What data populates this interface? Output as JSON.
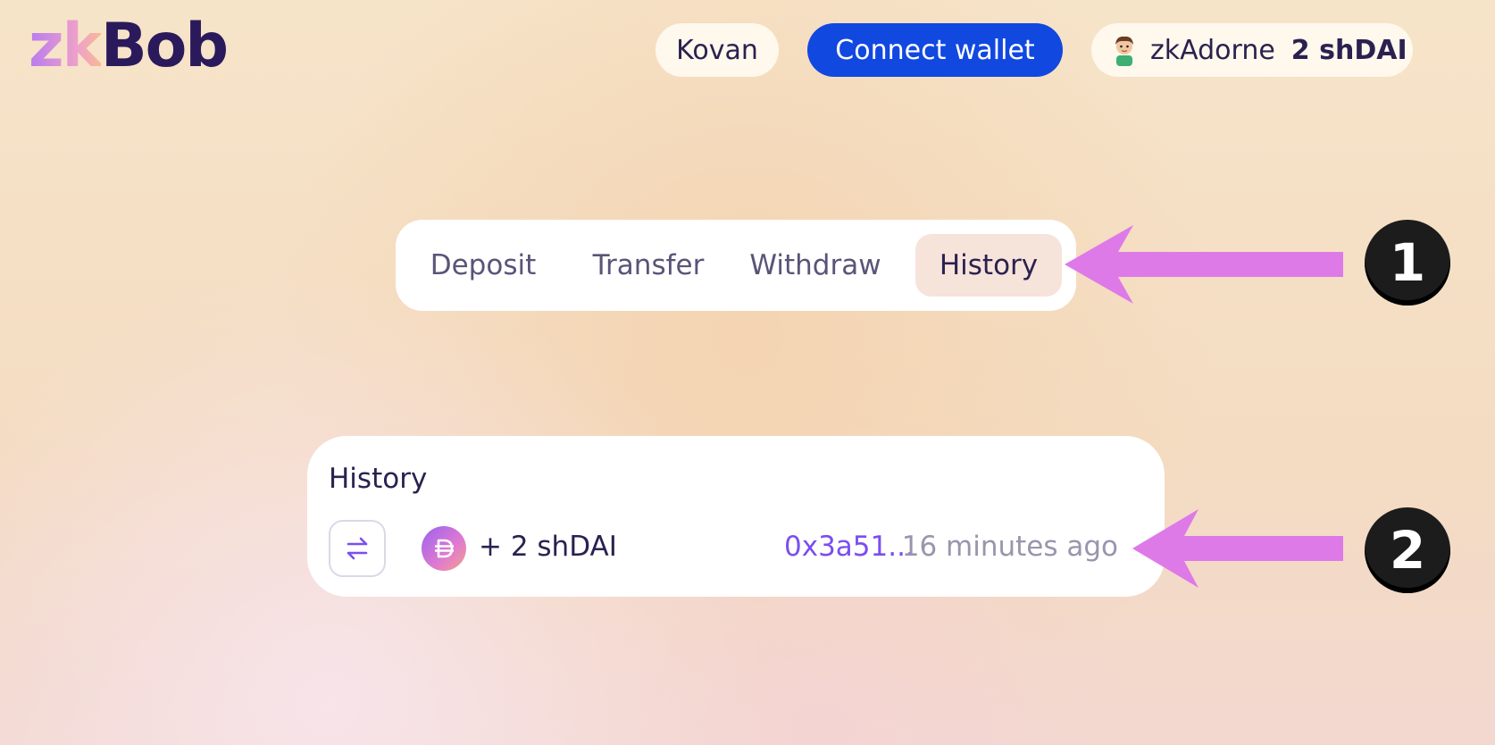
{
  "header": {
    "logo_part1": "zk",
    "logo_part2": "Bob",
    "network_label": "Kovan",
    "connect_wallet_label": "Connect wallet",
    "account_name": "zkAdorne",
    "account_balance": "2 shDAI"
  },
  "tabs": [
    {
      "label": "Deposit",
      "active": false
    },
    {
      "label": "Transfer",
      "active": false
    },
    {
      "label": "Withdraw",
      "active": false
    },
    {
      "label": "History",
      "active": true
    }
  ],
  "history": {
    "title": "History",
    "transactions": [
      {
        "type_icon": "transfer-arrows-icon",
        "token_icon": "dai-token-icon",
        "amount": "+ 2 shDAI",
        "hash": "0x3a51...",
        "time": "16 minutes ago"
      }
    ]
  },
  "annotations": [
    {
      "number": "1"
    },
    {
      "number": "2"
    }
  ],
  "colors": {
    "accent_blue": "#1148e0",
    "brand_dark": "#2a1a5c",
    "link_purple": "#7a4ef0",
    "annotation_arrow": "#dd7ae8",
    "active_tab_bg": "#f6e3da"
  }
}
